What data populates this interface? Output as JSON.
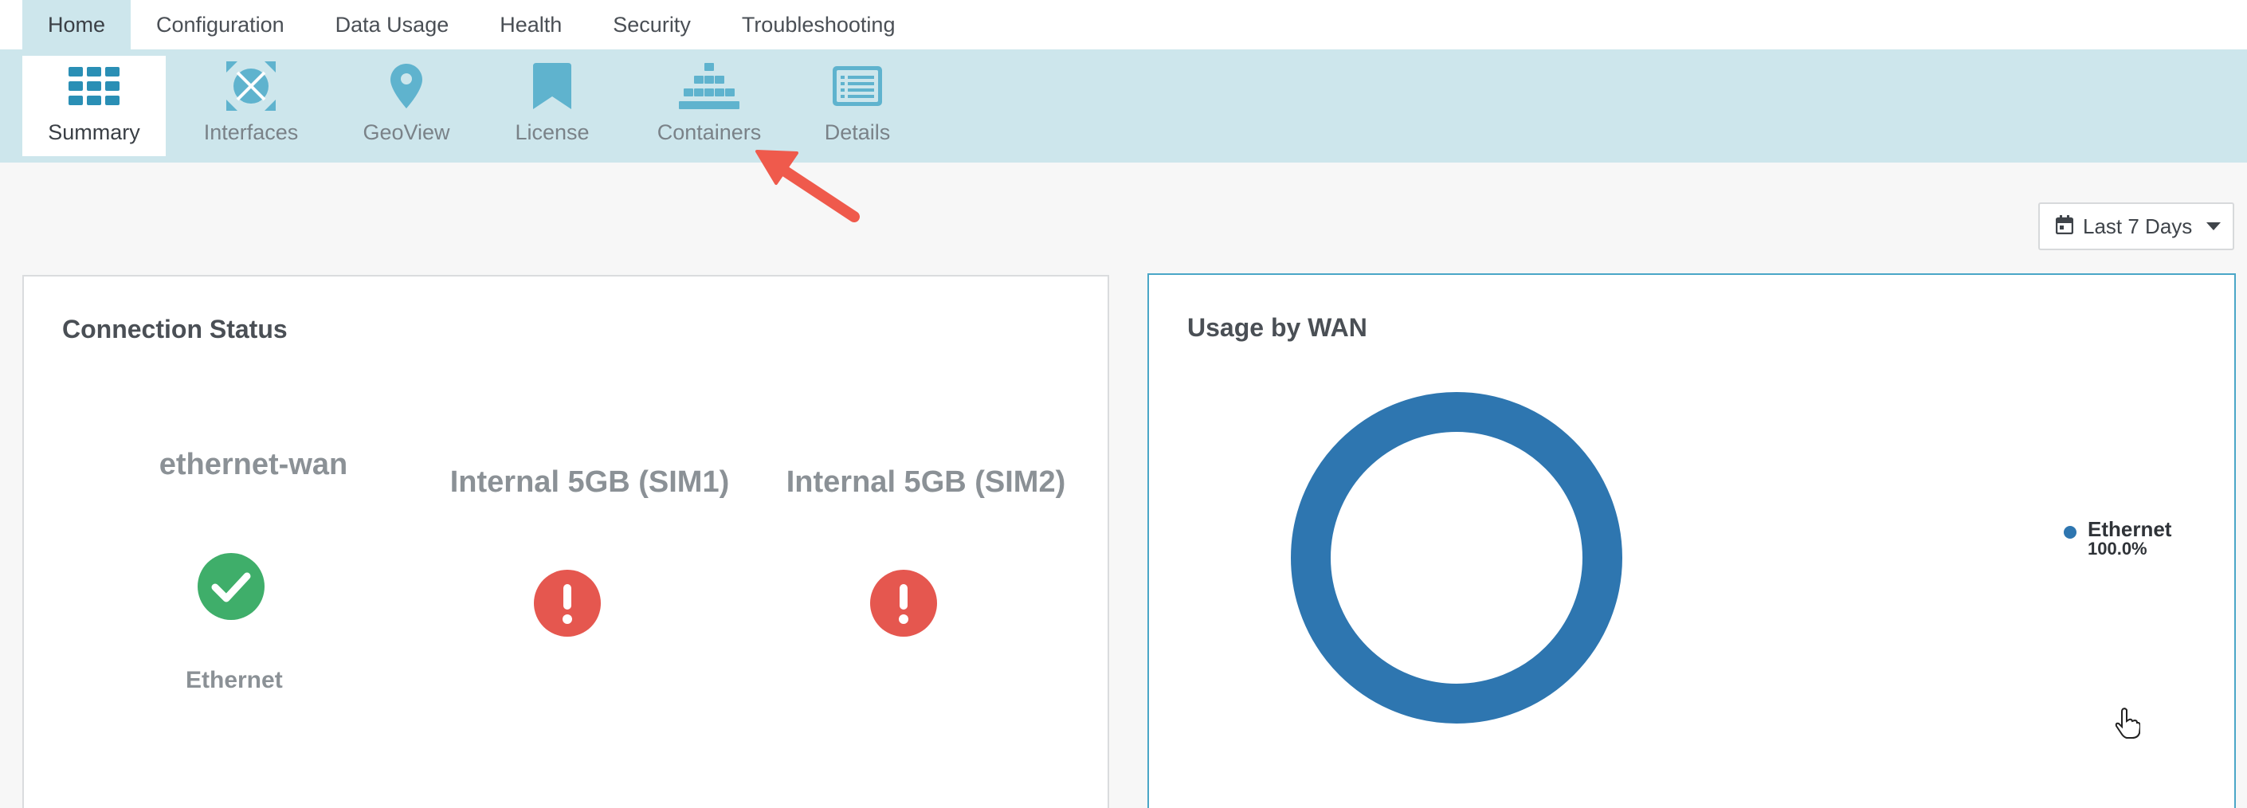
{
  "top_tabs": [
    {
      "label": "Home",
      "active": true
    },
    {
      "label": "Configuration"
    },
    {
      "label": "Data Usage"
    },
    {
      "label": "Health"
    },
    {
      "label": "Security"
    },
    {
      "label": "Troubleshooting"
    }
  ],
  "sub_tabs": [
    {
      "label": "Summary",
      "icon": "grid-icon",
      "active": true
    },
    {
      "label": "Interfaces",
      "icon": "interfaces-icon"
    },
    {
      "label": "GeoView",
      "icon": "map-pin-icon"
    },
    {
      "label": "License",
      "icon": "bookmark-icon"
    },
    {
      "label": "Containers",
      "icon": "containers-icon"
    },
    {
      "label": "Details",
      "icon": "details-list-icon"
    }
  ],
  "date_range": {
    "label": "Last 7 Days",
    "icon": "calendar-icon"
  },
  "connection_status": {
    "title": "Connection Status",
    "connections": [
      {
        "name": "ethernet-wan",
        "status": "connected",
        "type": "Ethernet",
        "icon": "check-circle-icon"
      },
      {
        "name": "Internal 5GB (SIM1)",
        "status": "error",
        "icon": "alert-circle-icon"
      },
      {
        "name": "Internal 5GB (SIM2)",
        "status": "error",
        "icon": "alert-circle-icon"
      }
    ]
  },
  "usage_by_wan": {
    "title": "Usage by WAN",
    "legend": [
      {
        "name": "Ethernet",
        "percent": "100.0%"
      }
    ]
  },
  "chart_data": {
    "type": "pie",
    "categories": [
      "Ethernet"
    ],
    "values": [
      100.0
    ]
  },
  "colors": {
    "accent": "#4aa6c7",
    "subnav_bg": "#cde6ec",
    "icon_blue": "#5fb3ce",
    "success": "#3fae6a",
    "error": "#e5574f",
    "donut": "#2e76b0",
    "annotation_arrow": "#ef5a4c"
  }
}
